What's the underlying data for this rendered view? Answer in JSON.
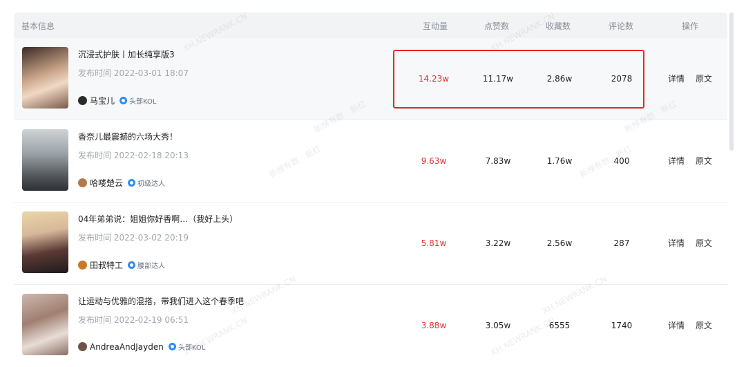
{
  "header": {
    "basic_info": "基本信息",
    "interactions": "互动量",
    "likes": "点赞数",
    "favorites": "收藏数",
    "comments": "评论数",
    "actions": "操作"
  },
  "colors": {
    "accent_red": "#e03131",
    "highlight_border": "#e5271f",
    "level_icon": "#2d8cf0"
  },
  "rows": [
    {
      "title": "沉浸式护肤丨加长纯享版3",
      "pubtime": "发布时间 2022-03-01 18:07",
      "author": "马宝儿",
      "level": "头部KOL",
      "interactions": "14.23w",
      "likes": "11.17w",
      "favorites": "2.86w",
      "comments": "2078",
      "detail": "详情",
      "original": "原文"
    },
    {
      "title": "香奈儿最震撼的六场大秀！",
      "pubtime": "发布时间 2022-02-18 20:13",
      "author": "哈喽楚云",
      "level": "初级达人",
      "interactions": "9.63w",
      "likes": "7.83w",
      "favorites": "1.76w",
      "comments": "400",
      "detail": "详情",
      "original": "原文"
    },
    {
      "title": "04年弟弟说：姐姐你好香啊…（我好上头）",
      "pubtime": "发布时间 2022-03-02 20:19",
      "author": "田叔特工",
      "level": "腰部达人",
      "interactions": "5.81w",
      "likes": "3.22w",
      "favorites": "2.56w",
      "comments": "287",
      "detail": "详情",
      "original": "原文"
    },
    {
      "title": "让运动与优雅的混搭，带我们进入这个春季吧",
      "pubtime": "发布时间 2022-02-19 06:51",
      "author": "AndreaAndJayden",
      "level": "头部KOL",
      "interactions": "3.88w",
      "likes": "3.05w",
      "favorites": "6555",
      "comments": "1740",
      "detail": "详情",
      "original": "原文"
    }
  ],
  "watermarks": {
    "latin": "XH.NEWRANK.CN",
    "cn": "新榜有数 · 新红"
  }
}
